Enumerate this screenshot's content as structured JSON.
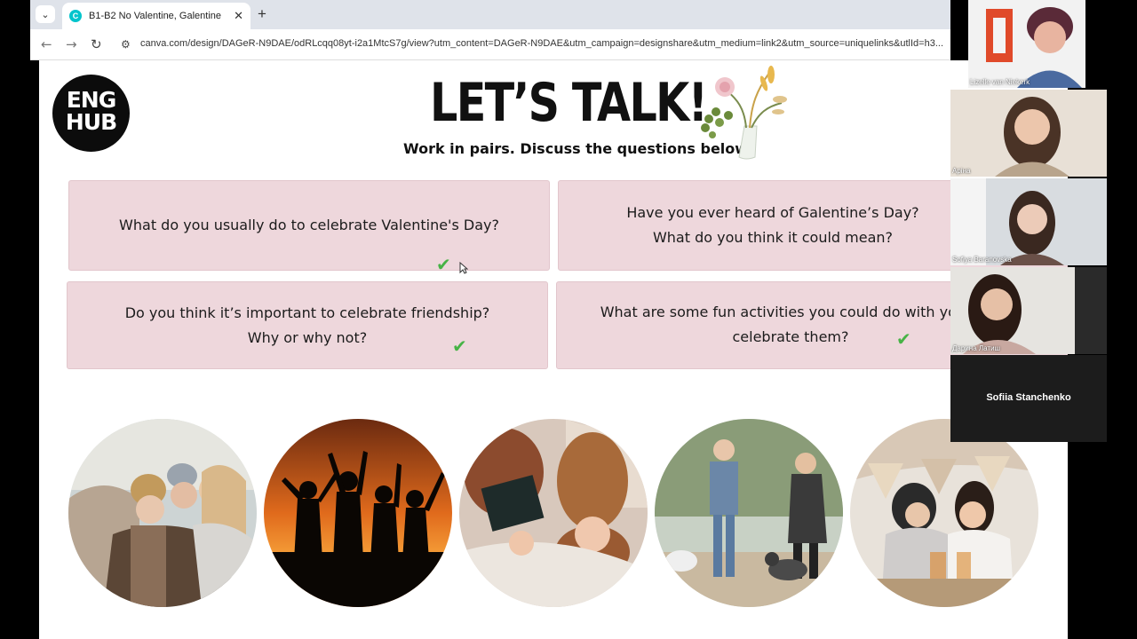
{
  "browser": {
    "tab_title": "B1-B2 No Valentine, Galentine",
    "tab_favicon_letter": "C",
    "url": "canva.com/design/DAGeR-N9DAE/odRLcqq08yt-i2a1MtcS7g/view?utm_content=DAGeR-N9DAE&utm_campaign=designshare&utm_medium=link2&utm_source=uniquelinks&utlId=h3..."
  },
  "slide": {
    "logo_line1": "ENG",
    "logo_line2": "HUB",
    "title": "LET’S TALK!",
    "subtitle": "Work in pairs. Discuss the questions below.",
    "questions": [
      {
        "line1": "What do you usually do to celebrate Valentine's Day?",
        "line2": "",
        "checked": true
      },
      {
        "line1": "Have you ever heard of Galentine’s Day?",
        "line2": "What do you think it could mean?",
        "checked": false
      },
      {
        "line1": "Do you think it’s important to celebrate friendship?",
        "line2": "Why or why not?",
        "checked": true
      },
      {
        "line1": "What are some fun activities you could do with your f",
        "line2": "celebrate them?",
        "checked": true
      }
    ],
    "check_color": "#47b346",
    "card_color": "#eed7dc"
  },
  "participants": [
    {
      "name": "Lizelle van Niekerk"
    },
    {
      "name": "Аріна"
    },
    {
      "name": "Sofiya Baranovska"
    },
    {
      "name": "Дарина Латиш"
    },
    {
      "name": "Sofiia Stanchenko"
    }
  ]
}
